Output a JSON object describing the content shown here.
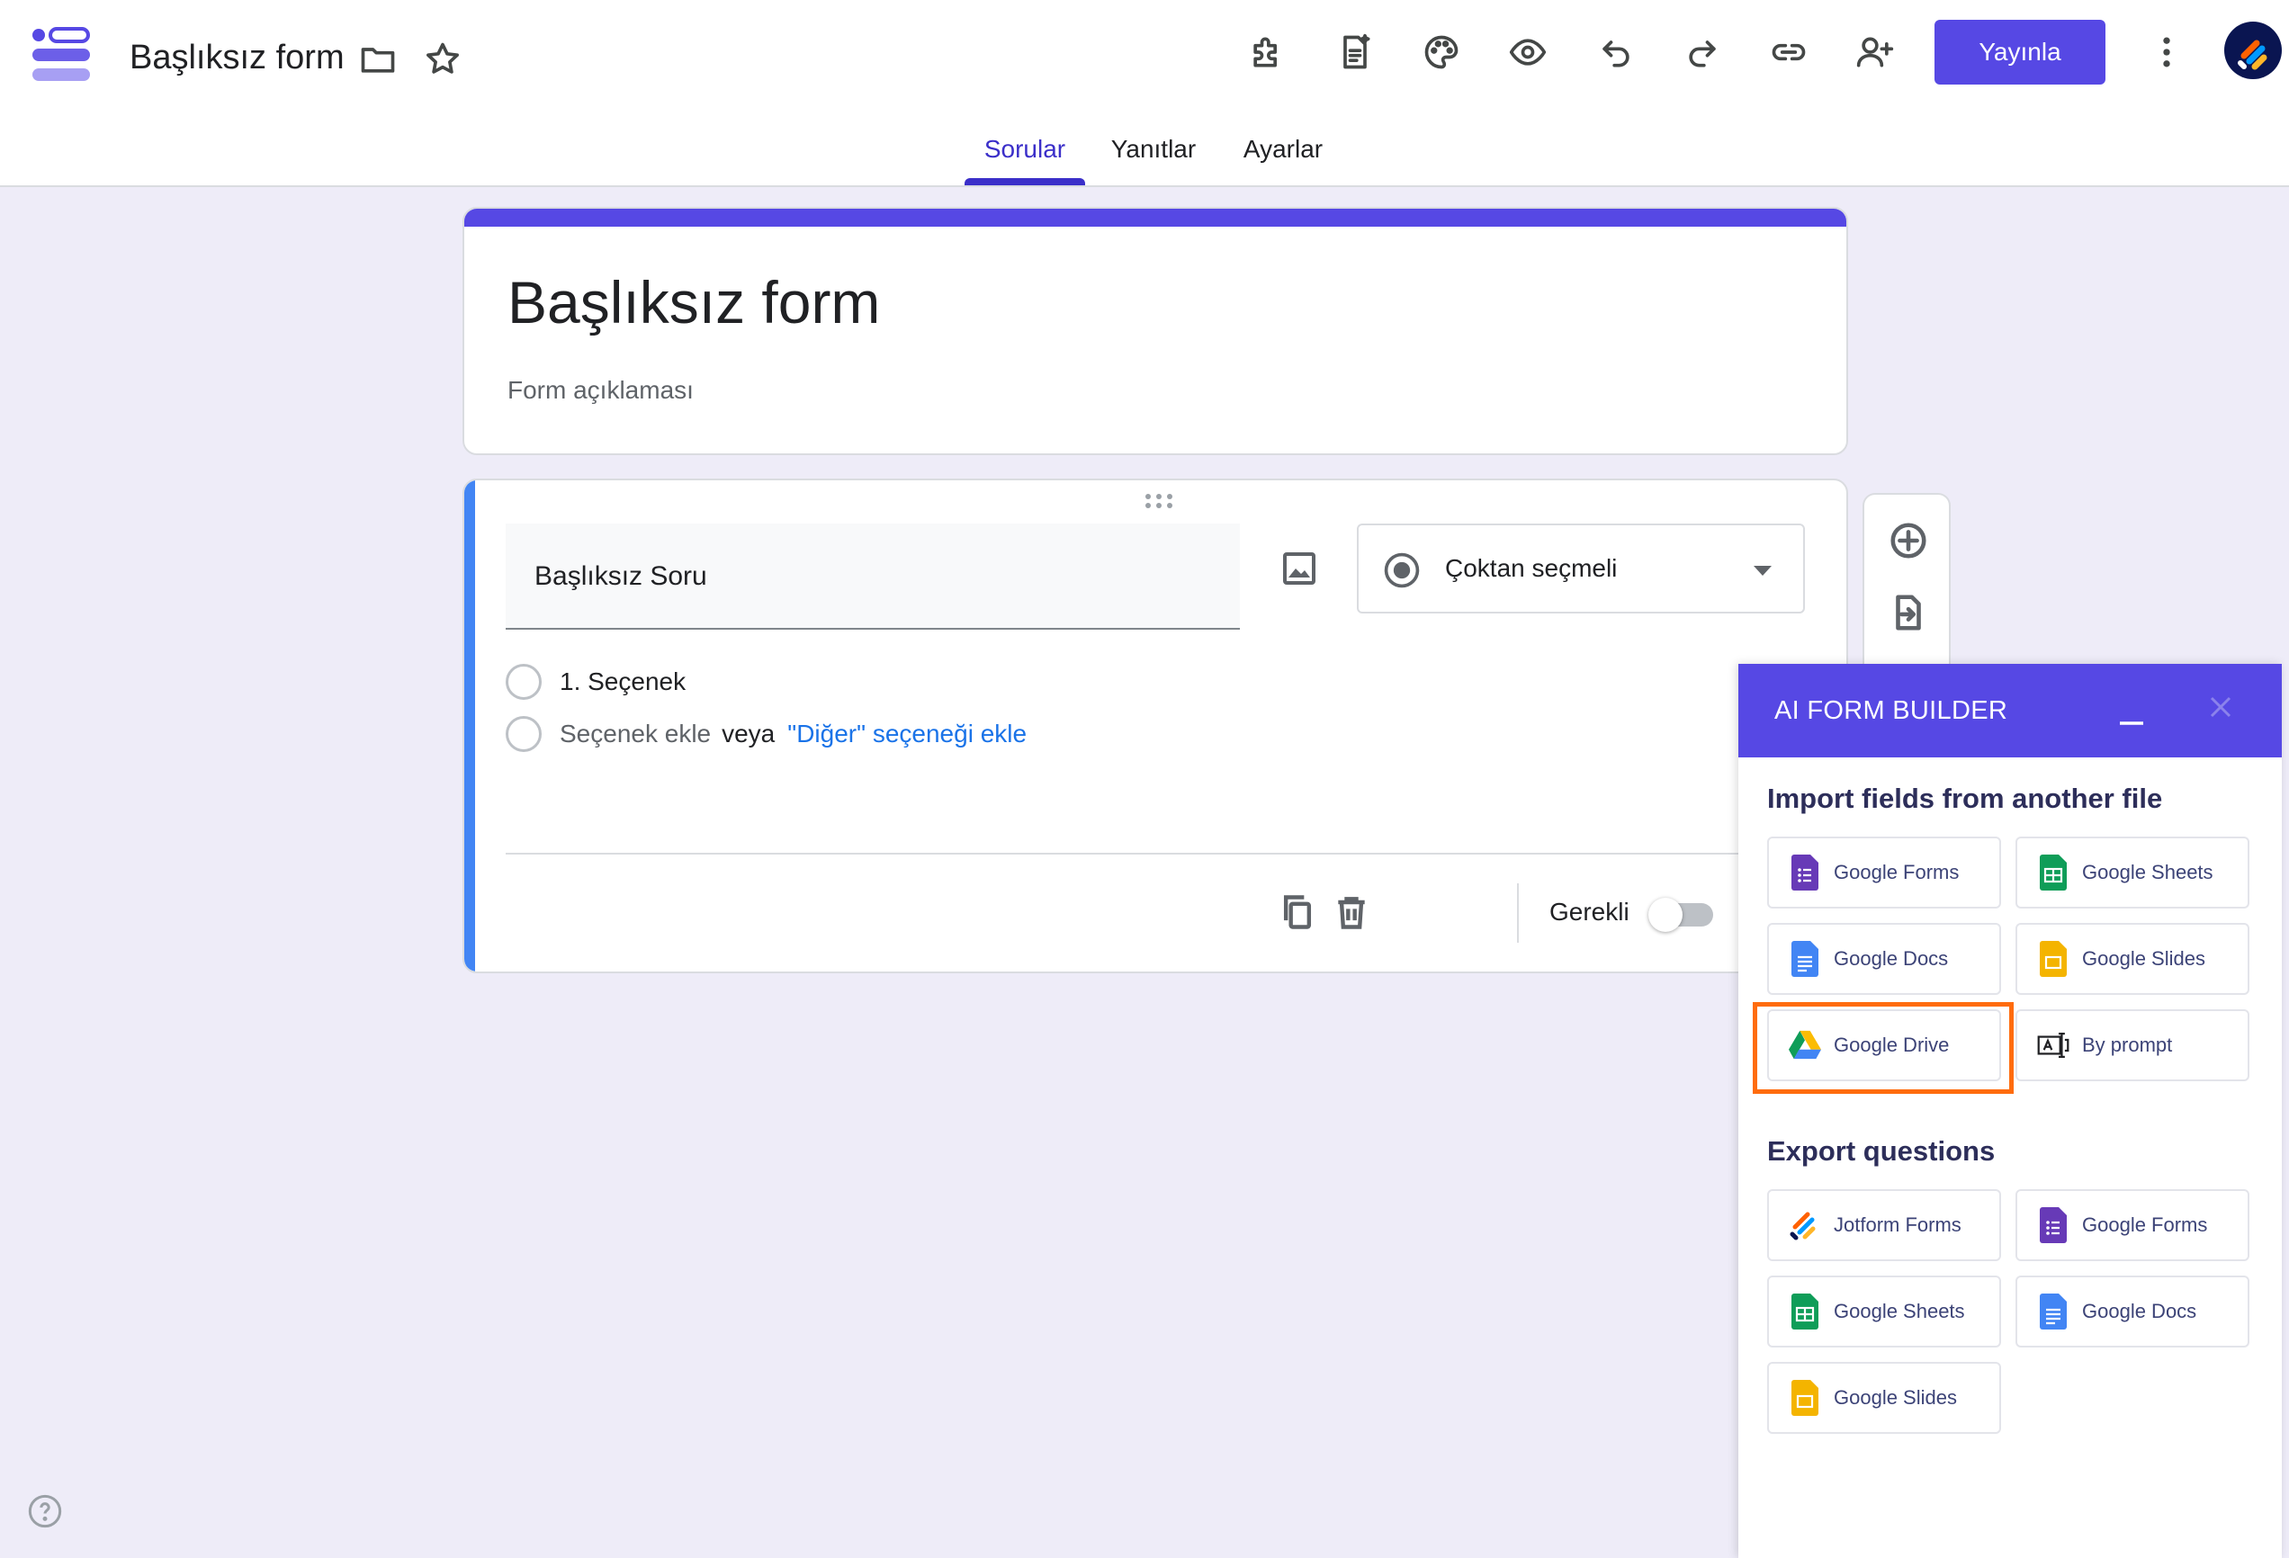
{
  "header": {
    "doc_title": "Başlıksız form",
    "publish_label": "Yayınla"
  },
  "tabs": [
    {
      "label": "Sorular",
      "active": true
    },
    {
      "label": "Yanıtlar",
      "active": false
    },
    {
      "label": "Ayarlar",
      "active": false
    }
  ],
  "form": {
    "title": "Başlıksız form",
    "description_placeholder": "Form açıklaması"
  },
  "question": {
    "title_placeholder": "Başlıksız Soru",
    "type_label": "Çoktan seçmeli",
    "option_1": "1. Seçenek",
    "add_option": "Seçenek ekle",
    "or": "veya",
    "add_other": "\"Diğer\" seçeneği ekle",
    "required_label": "Gerekli",
    "required_on": false
  },
  "ai_panel": {
    "title": "AI FORM BUILDER",
    "import_title": "Import fields from another file",
    "import_items": [
      {
        "label": "Google Forms",
        "icon": "google-forms-icon"
      },
      {
        "label": "Google Sheets",
        "icon": "google-sheets-icon"
      },
      {
        "label": "Google Docs",
        "icon": "google-docs-icon"
      },
      {
        "label": "Google Slides",
        "icon": "google-slides-icon"
      },
      {
        "label": "Google Drive",
        "icon": "google-drive-icon"
      },
      {
        "label": "By prompt",
        "icon": "prompt-icon"
      }
    ],
    "export_title": "Export questions",
    "export_items": [
      {
        "label": "Jotform Forms",
        "icon": "jotform-icon"
      },
      {
        "label": "Google Forms",
        "icon": "google-forms-icon"
      },
      {
        "label": "Google Sheets",
        "icon": "google-sheets-icon"
      },
      {
        "label": "Google Docs",
        "icon": "google-docs-icon"
      },
      {
        "label": "Google Slides",
        "icon": "google-slides-icon"
      }
    ]
  },
  "colors": {
    "brand": "#5648e4",
    "accent_blue": "#4285f4",
    "link": "#1a73e8",
    "highlight": "#ff6c0d",
    "background": "#eeecf8"
  }
}
